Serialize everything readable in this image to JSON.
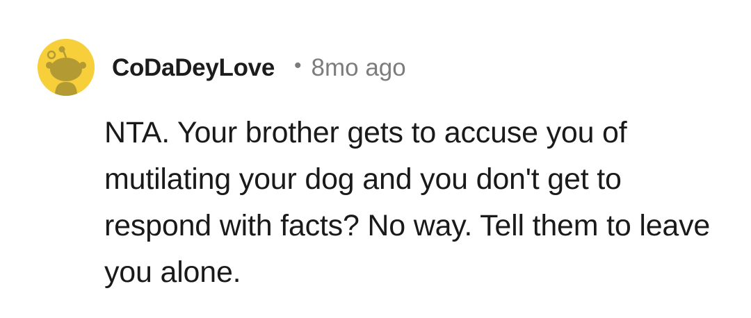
{
  "comment": {
    "avatar": {
      "icon": "snoo-avatar-icon",
      "background_color": "#f6cf3b"
    },
    "username": "CoDaDeyLove",
    "separator": "•",
    "timestamp": "8mo ago",
    "body": "NTA. Your brother gets to accuse you of mutilating your dog and you don't get to respond with facts? No way. Tell them to leave you alone."
  }
}
